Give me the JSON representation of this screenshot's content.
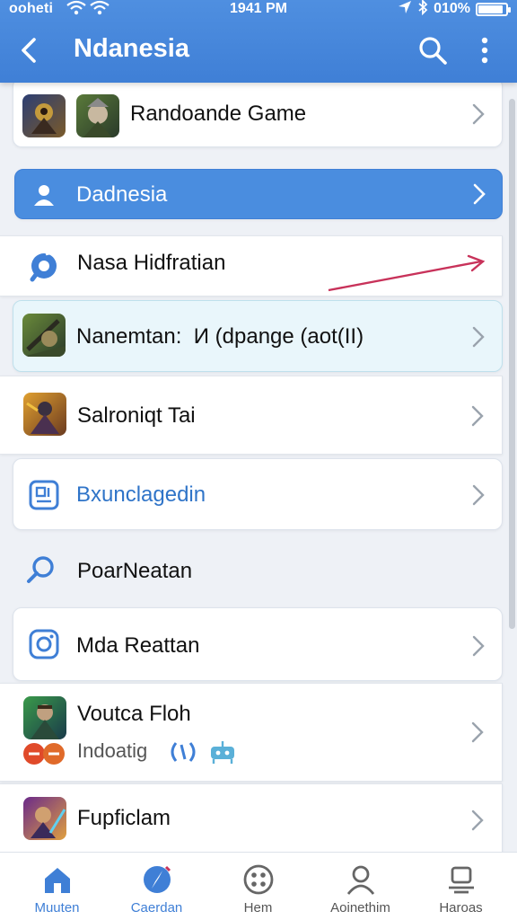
{
  "status_bar": {
    "carrier": "ooheti",
    "time": "1941 PM",
    "battery": "010%",
    "battery_level": 0.9
  },
  "header": {
    "title": "Ndanesia"
  },
  "list": {
    "item_game": {
      "label": "Randoande Game"
    },
    "item_profile": {
      "label": "Dadnesia"
    },
    "item_hidfratian": {
      "label": "Nasa Hidfratian"
    },
    "item_nanemtan": {
      "label": "Nanemtan:  И (dpange (aot(II)"
    },
    "item_salroniqt": {
      "label": "Salroniqt Tai"
    },
    "item_bxunclagedin": {
      "label": "Bxunclagedin"
    },
    "item_poarneatan": {
      "label": "PoarNeatan"
    },
    "item_mda_reattan": {
      "label": "Mda Reattan"
    },
    "item_voutca": {
      "label": "Voutca Floh",
      "sub_label": "Indoatig"
    },
    "item_fupficlam": {
      "label": "Fupficlam"
    }
  },
  "tabbar": {
    "tabs": [
      {
        "label": "Muuten",
        "icon": "home-icon",
        "active": true
      },
      {
        "label": "Caerdan",
        "icon": "compass-icon",
        "active": true
      },
      {
        "label": "Hem",
        "icon": "grid-circle-icon",
        "active": false
      },
      {
        "label": "Aoinethim",
        "icon": "person-icon",
        "active": false
      },
      {
        "label": "Haroas",
        "icon": "monitor-icon",
        "active": false
      }
    ]
  },
  "colors": {
    "brand": "#3f7fd6",
    "accent_card": "#4a8ddf",
    "highlight_card": "#e9f6fb",
    "arrow_annotation": "#c8325a"
  }
}
